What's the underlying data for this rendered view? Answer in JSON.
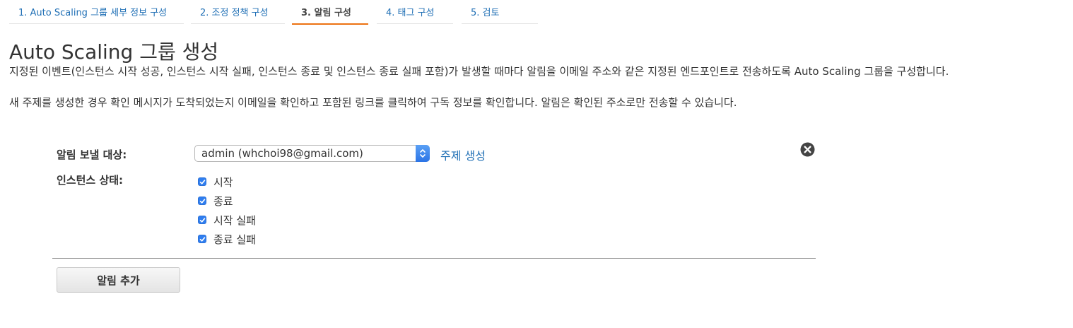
{
  "steps": [
    {
      "label": "1. Auto Scaling 그룹 세부 정보 구성",
      "active": false
    },
    {
      "label": "2. 조정 정책 구성",
      "active": false
    },
    {
      "label": "3. 알림 구성",
      "active": true
    },
    {
      "label": "4. 태그 구성",
      "active": false
    },
    {
      "label": "5. 검토",
      "active": false
    }
  ],
  "page": {
    "title": "Auto Scaling 그룹 생성",
    "description1": "지정된 이벤트(인스턴스 시작 성공, 인스턴스 시작 실패, 인스턴스 종료 및 인스턴스 종료 실패 포함)가 발생할 때마다 알림을 이메일 주소와 같은 지정된 엔드포인트로 전송하도록 Auto Scaling 그룹을 구성합니다.",
    "description2": "새 주제를 생성한 경우 확인 메시지가 도착되었는지 이메일을 확인하고 포함된 링크를 클릭하여 구독 정보를 확인합니다. 알림은 확인된 주소로만 전송할 수 있습니다."
  },
  "notification": {
    "send_to_label": "알림 보낼 대상:",
    "send_to_value": "admin (whchoi98@gmail.com)",
    "create_topic_link": "주제 생성",
    "instance_state_label": "인스턴스 상태:",
    "states": [
      {
        "label": "시작",
        "checked": true
      },
      {
        "label": "종료",
        "checked": true
      },
      {
        "label": "시작 실패",
        "checked": true
      },
      {
        "label": "종료 실패",
        "checked": true
      }
    ],
    "remove_icon": "close-circle-icon"
  },
  "add_notification_button": "알림 추가",
  "colors": {
    "link": "#1f6fb5",
    "active_tab_underline": "#ec7211",
    "checkbox": "#2f7ef0"
  }
}
